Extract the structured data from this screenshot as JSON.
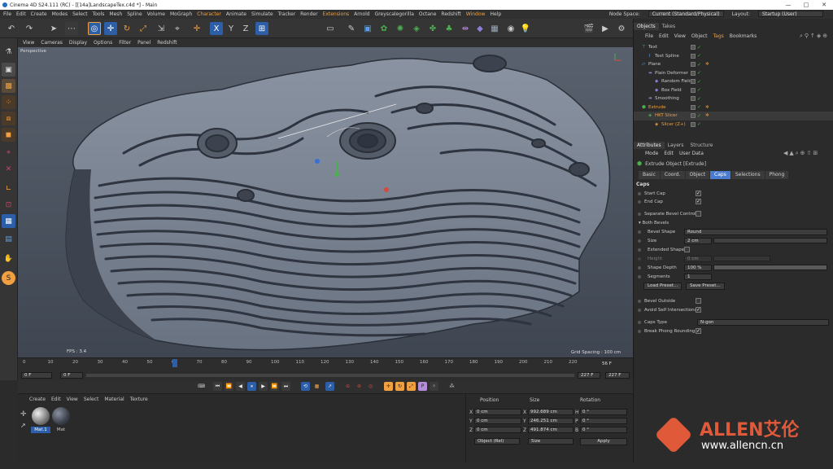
{
  "title": "Cinema 4D S24.111 (RC) - [[14a]LandscapeTex.c4d *] - Main",
  "window_buttons": [
    "—",
    "□",
    "✕"
  ],
  "menubar": [
    "File",
    "Edit",
    "Create",
    "Modes",
    "Select",
    "Tools",
    "Mesh",
    "Spline",
    "Volume",
    "MoGraph",
    "Character",
    "Animate",
    "Simulate",
    "Tracker",
    "Render",
    "Extensions",
    "Arnold",
    "Greyscalegorilla",
    "Octane",
    "Redshift",
    "Window",
    "Help"
  ],
  "node_space_label": "Node Space:",
  "node_space_value": "Current (Standard/Physical)",
  "layout_label": "Layout:",
  "layout_value": "Startup (User)",
  "viewport_menu": [
    "View",
    "Cameras",
    "Display",
    "Options",
    "Filter",
    "Panel",
    "Redshift"
  ],
  "viewport_label": "Perspective",
  "fps": "FPS : 3.4",
  "grid_spacing": "Grid Spacing : 100 cm",
  "timeline_ticks": [
    "0",
    "10",
    "20",
    "30",
    "40",
    "50",
    "60",
    "70",
    "80",
    "90",
    "100",
    "110",
    "120",
    "130",
    "140",
    "150",
    "160",
    "170",
    "180",
    "190",
    "200",
    "210",
    "220"
  ],
  "timeline_current": "56 F",
  "frame_start": "0 F",
  "frame_min": "0 F",
  "frame_end": "227 F",
  "frame_max": "227 F",
  "material_menu": [
    "Create",
    "Edit",
    "View",
    "Select",
    "Material",
    "Texture"
  ],
  "materials": [
    "Mat.1",
    "Mat"
  ],
  "coord_headers": {
    "position": "Position",
    "size": "Size",
    "rotation": "Rotation"
  },
  "coords": {
    "x_pos": "0 cm",
    "y_pos": "0 cm",
    "z_pos": "0 cm",
    "x_size": "992.689 cm",
    "y_size": "246.251 cm",
    "z_size": "491.874 cm",
    "h_rot": "0 °",
    "p_rot": "0 °",
    "b_rot": "0 °"
  },
  "coord_mode": "Object (Rel)",
  "coord_size_mode": "Size",
  "apply_label": "Apply",
  "objects_tabs": [
    "Objects",
    "Takes"
  ],
  "objects_menu": [
    "File",
    "Edit",
    "View",
    "Object",
    "Tags",
    "Bookmarks"
  ],
  "objects": [
    {
      "name": "Text",
      "indent": 0
    },
    {
      "name": "Text Spline",
      "indent": 1
    },
    {
      "name": "Plane",
      "indent": 0
    },
    {
      "name": "Plain Deformer",
      "indent": 1
    },
    {
      "name": "Random Field",
      "indent": 2
    },
    {
      "name": "Box Field",
      "indent": 2
    },
    {
      "name": "Smoothing",
      "indent": 1
    },
    {
      "name": "Extrude",
      "indent": 0
    },
    {
      "name": "HKT Slicer",
      "indent": 1
    },
    {
      "name": "Slicer (Z+)",
      "indent": 2
    }
  ],
  "attr_tabs": [
    "Attributes",
    "Layers",
    "Structure"
  ],
  "attr_menu": [
    "Mode",
    "Edit",
    "User Data"
  ],
  "attr_object": "Extrude Object [Extrude]",
  "attr_subtabs": [
    "Basic",
    "Coord.",
    "Object",
    "Caps",
    "Selections",
    "Phong"
  ],
  "caps_title": "Caps",
  "start_cap": "Start Cap",
  "end_cap": "End Cap",
  "separate_bevel": "Separate Bevel Controls",
  "both_bevels": "▾ Both Bevels",
  "bevel_shape_label": "Bevel Shape",
  "bevel_shape_value": "Round",
  "size_label": "Size",
  "size_value": "2 cm",
  "extended_shape": "Extended Shape",
  "height_label": "Height",
  "height_value": "0 cm",
  "shape_depth_label": "Shape Depth",
  "shape_depth_value": "100 %",
  "segments_label": "Segments",
  "segments_value": "1",
  "load_preset": "Load Preset...",
  "save_preset": "Save Preset...",
  "bevel_outside": "Bevel Outside",
  "avoid_self": "Avoid Self Intersections",
  "caps_type_label": "Caps Type",
  "caps_type_value": "N-gon",
  "break_phong": "Break Phong Rounding",
  "watermark_brand": "ALLEN艾伦",
  "watermark_url": "www.allencn.cn"
}
